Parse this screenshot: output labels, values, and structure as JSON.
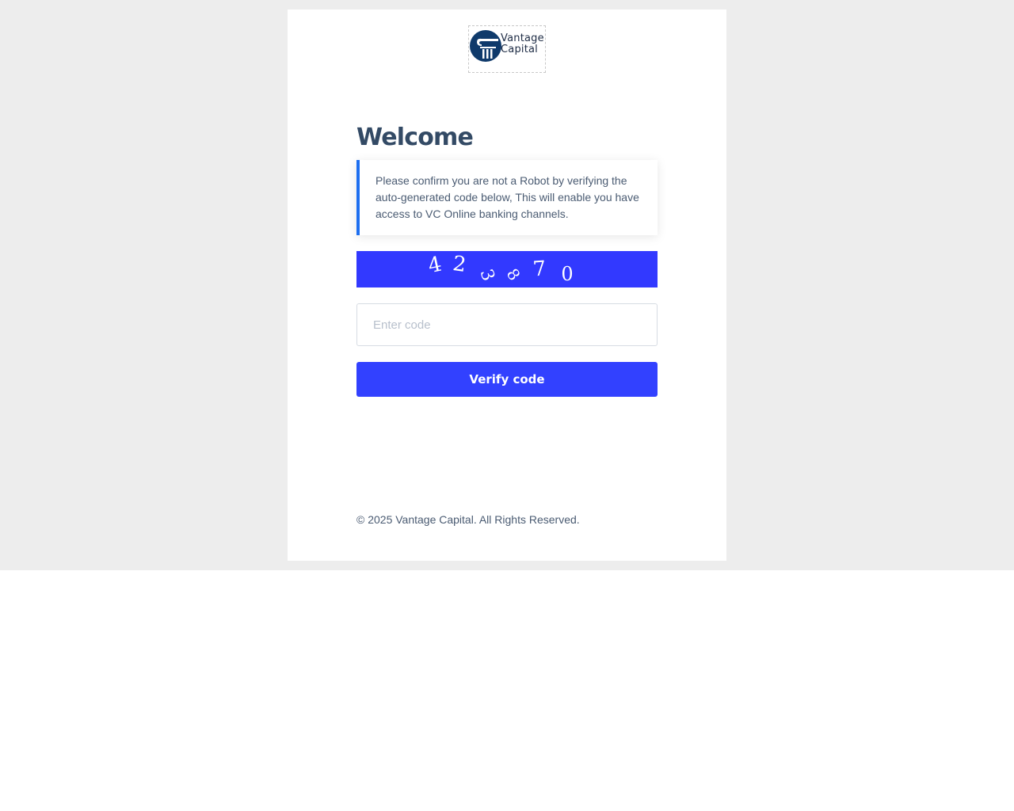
{
  "brand": {
    "name_line1": "Vantage",
    "name_line2": "Capital",
    "emblem_color": "#0f3a6b"
  },
  "main": {
    "title": "Welcome",
    "notice": "Please confirm you are not a Robot by verifying the auto-generated code below, This will enable you have access to VC Online banking channels.",
    "captcha": {
      "characters": [
        "4",
        "2",
        "3",
        "8",
        "7",
        "0"
      ],
      "background": "#3239ff"
    },
    "code_input": {
      "placeholder": "Enter code",
      "value": ""
    },
    "verify_label": "Verify code",
    "accent_color": "#3241ff"
  },
  "footer": {
    "copyright": "© 2025 Vantage Capital. All Rights Reserved."
  }
}
